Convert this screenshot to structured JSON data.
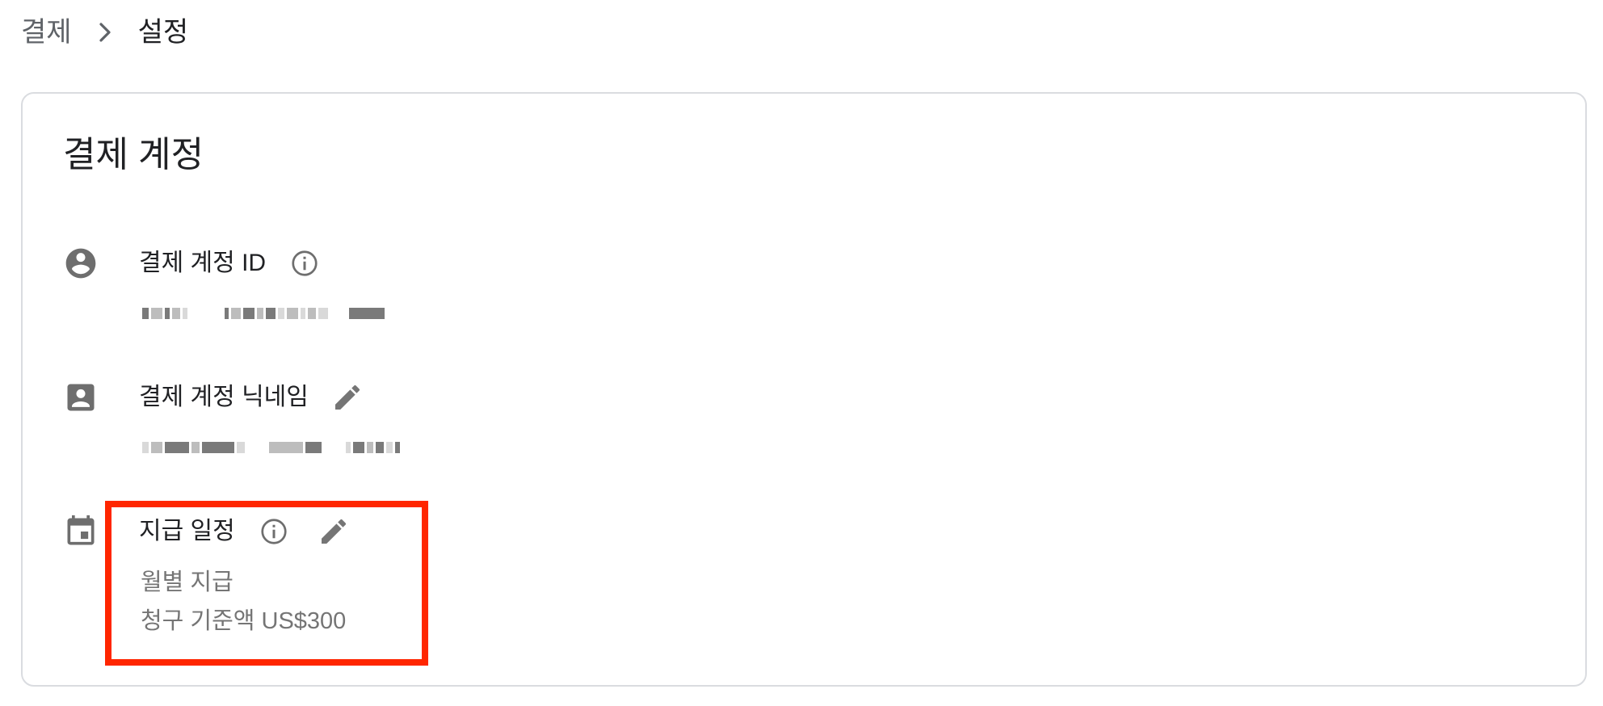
{
  "breadcrumb": {
    "parent": "결제",
    "separator_icon": "chevron-right-icon",
    "current": "설정"
  },
  "card": {
    "title": "결제 계정",
    "rows": [
      {
        "icon": "account-circle-icon",
        "label": "결제 계정 ID",
        "actions": [
          "info-icon"
        ],
        "value_redacted": true
      },
      {
        "icon": "contact-card-icon",
        "label": "결제 계정 닉네임",
        "actions": [
          "edit-pencil-icon"
        ],
        "value_redacted": true
      },
      {
        "icon": "calendar-event-icon",
        "label": "지급 일정",
        "actions": [
          "info-icon",
          "edit-pencil-icon"
        ],
        "lines": [
          "월별 지급",
          "청구 기준액 US$300"
        ]
      }
    ]
  },
  "colors": {
    "text_primary": "#202124",
    "text_secondary": "#757575",
    "icon": "#6e6e6e",
    "card_border": "#dadce0",
    "highlight": "#ff2600"
  }
}
